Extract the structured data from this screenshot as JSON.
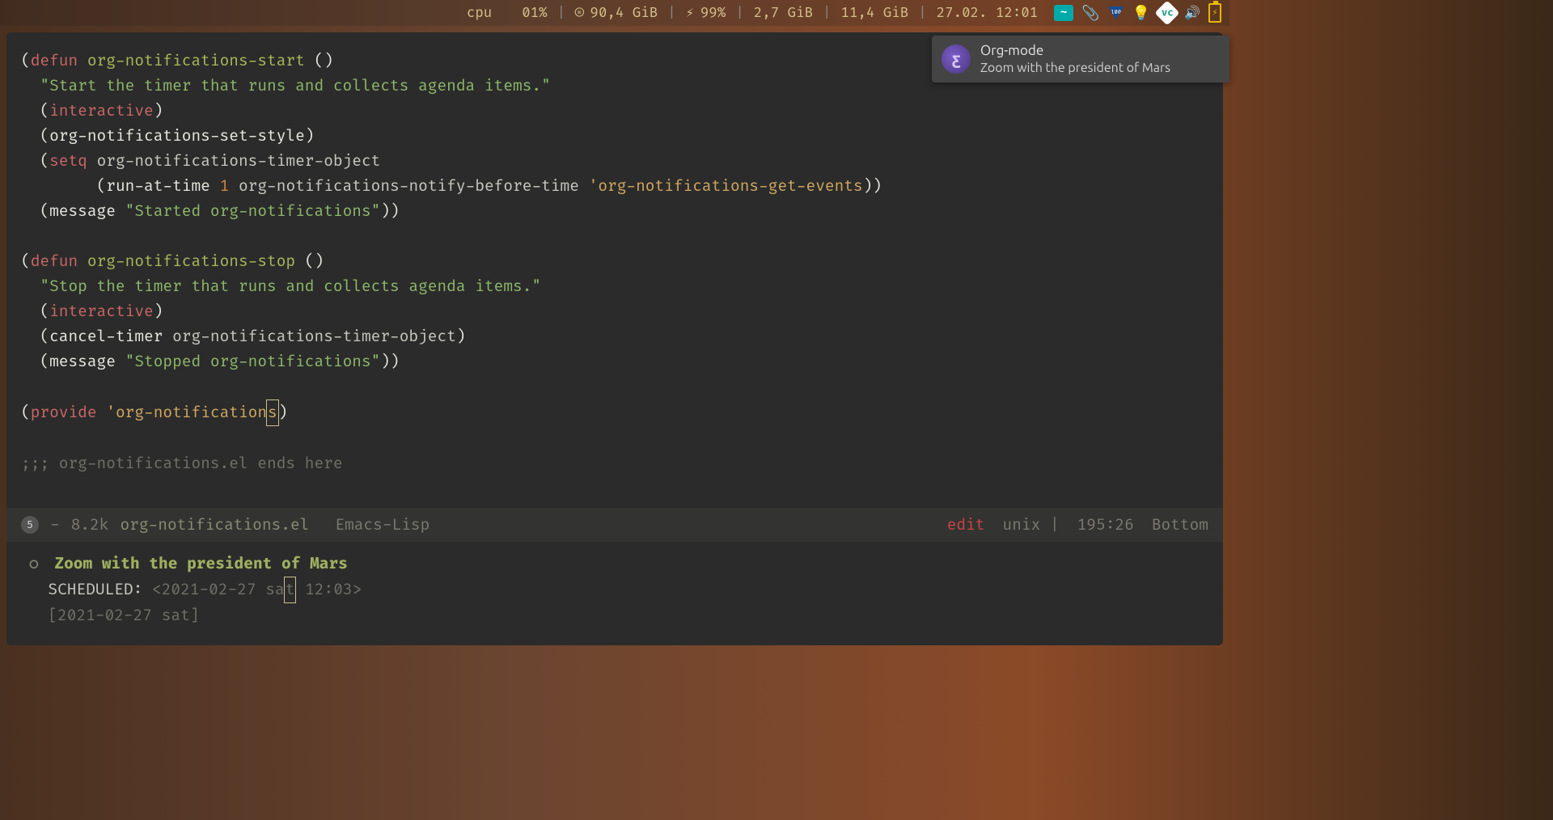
{
  "statusbar": {
    "cpu_label": "cpu",
    "cpu_value": "01%",
    "disk": "90,4 GiB",
    "battery": "99%",
    "mem1": "2,7 GiB",
    "mem2": "11,4 GiB",
    "datetime": "27.02. 12:01"
  },
  "code": {
    "l1_defun": "defun",
    "l1_name": "org-notifications-start",
    "l1_parens": "()",
    "l2_doc": "\"Start the timer that runs and collects agenda items.\"",
    "l3_inter": "interactive",
    "l4_fn": "org-notifications-set-style",
    "l5_setq": "setq",
    "l5_var": "org-notifications-timer-object",
    "l6_run": "run-at-time",
    "l6_num": "1",
    "l6_arg": "org-notifications-notify-before-time",
    "l6_quoted": "'org-notifications-get-events",
    "l7_msg": "message",
    "l7_str": "\"Started org-notifications\"",
    "l9_defun": "defun",
    "l9_name": "org-notifications-stop",
    "l9_parens": "()",
    "l10_doc": "\"Stop the timer that runs and collects agenda items.\"",
    "l11_inter": "interactive",
    "l12_cancel": "cancel-timer",
    "l12_arg": "org-notifications-timer-object",
    "l13_msg": "message",
    "l13_str": "\"Stopped org-notifications\"",
    "l15_provide": "provide",
    "l15_quoted_pre": "'org-notification",
    "l15_quoted_cur": "s",
    "l17_comment": ";;; org-notifications.el ends here"
  },
  "modeline": {
    "circle": "5",
    "dash": "-",
    "size": "8.2k",
    "filename": "org-notifications.el",
    "mode": "Emacs-Lisp",
    "edit": "edit",
    "unix": "unix",
    "sep": "|",
    "position": "195:26",
    "bottom": "Bottom"
  },
  "org": {
    "bullet": "○",
    "title": "Zoom with the president of Mars",
    "sched_label": "SCHEDULED:",
    "date_open": "<2021-02-27 sa",
    "date_cur": "t",
    "date_rest": " 12:03>",
    "date2": "[2021-02-27 sat]"
  },
  "notification": {
    "icon_glyph": "ƹ",
    "title": "Org-mode",
    "body": "Zoom with the president of Mars"
  }
}
